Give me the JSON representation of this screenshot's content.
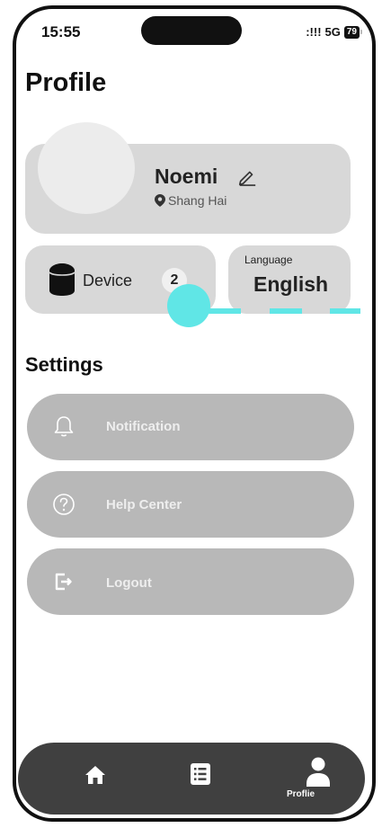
{
  "status_bar": {
    "time": "15:55",
    "signal": ":!!!",
    "network": "5G",
    "battery": "79"
  },
  "page": {
    "title": "Profile"
  },
  "profile": {
    "name": "Noemi",
    "location": "Shang Hai"
  },
  "device": {
    "label": "Device",
    "count": "2"
  },
  "language": {
    "label": "Language",
    "value": "English"
  },
  "settings": {
    "title": "Settings",
    "items": [
      {
        "label": "Notification",
        "icon": "bell-icon"
      },
      {
        "label": "Help Center",
        "icon": "help-circle-icon"
      },
      {
        "label": "Logout",
        "icon": "logout-icon"
      }
    ]
  },
  "nav": {
    "items": [
      {
        "icon": "home-icon"
      },
      {
        "icon": "list-icon"
      },
      {
        "icon": "profile-icon",
        "label": "Proflie",
        "active": true
      }
    ]
  },
  "colors": {
    "accent": "#60e6e6",
    "card": "#d8d8d8",
    "button": "#b8b8b8",
    "nav": "#404040"
  }
}
